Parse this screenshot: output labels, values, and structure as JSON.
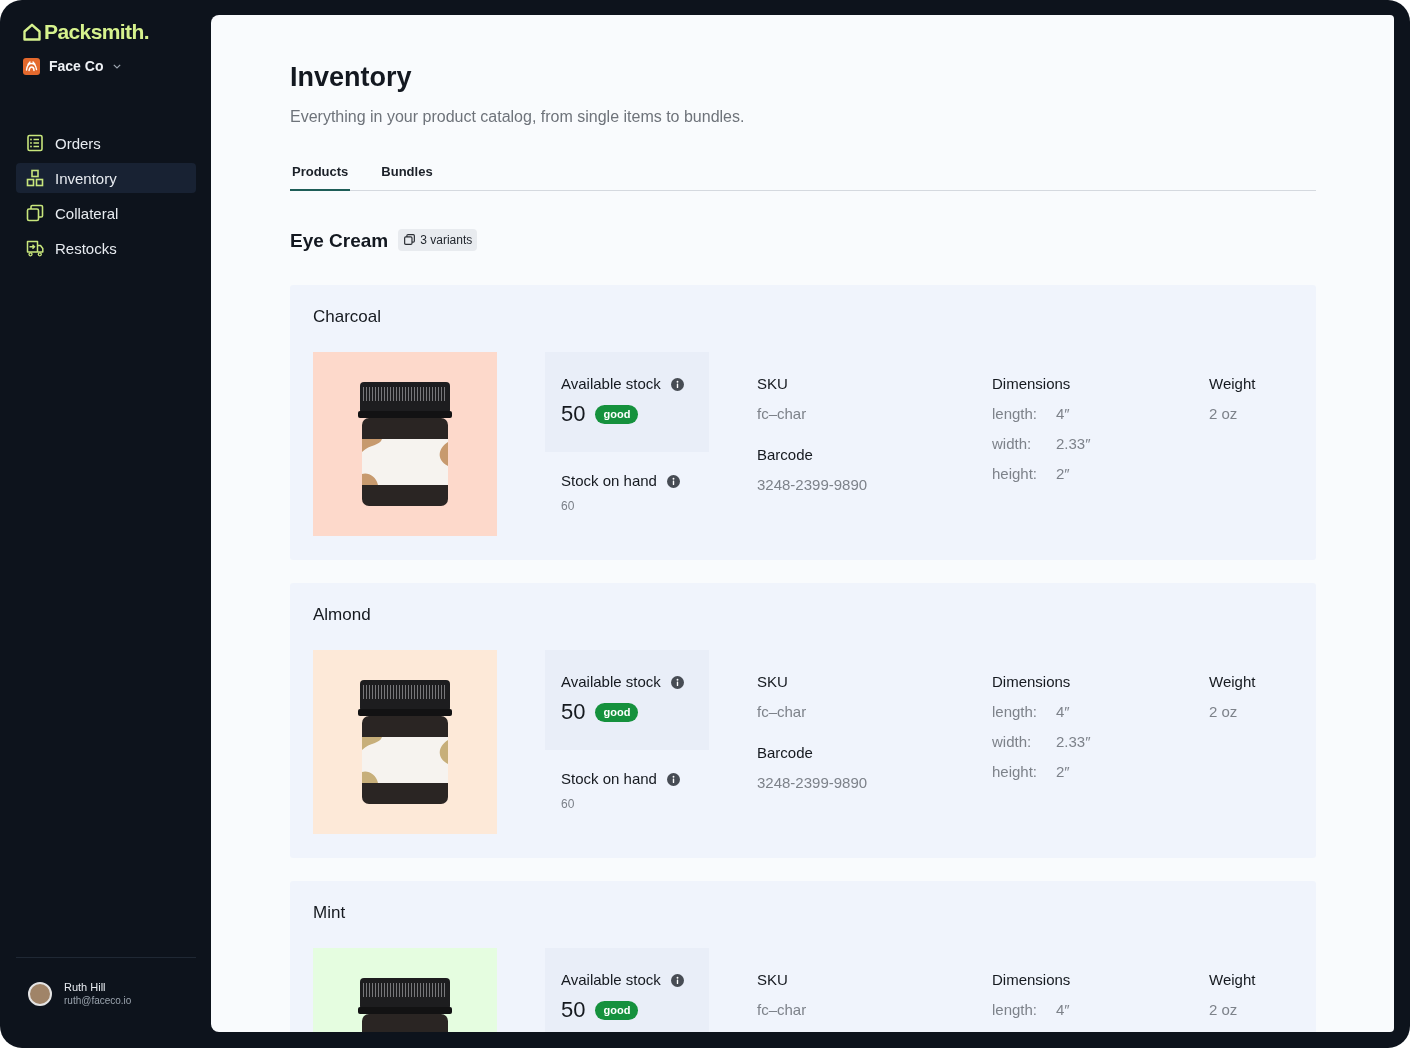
{
  "sidebar": {
    "logo": "Packsmith.",
    "org": "Face Co",
    "nav": [
      {
        "label": "Orders",
        "selected": false
      },
      {
        "label": "Inventory",
        "selected": true
      },
      {
        "label": "Collateral",
        "selected": false
      },
      {
        "label": "Restocks",
        "selected": false
      }
    ],
    "user": {
      "name": "Ruth Hill",
      "email": "ruth@faceco.io"
    }
  },
  "page": {
    "title": "Inventory",
    "subtitle": "Everything in your product catalog, from single items to bundles."
  },
  "tabs": [
    {
      "label": "Products",
      "selected": true
    },
    {
      "label": "Bundles",
      "selected": false
    }
  ],
  "product": {
    "name": "Eye Cream",
    "variants_badge": "3 variants"
  },
  "variants": [
    {
      "name": "Charcoal",
      "color": "#fdd9cb",
      "available_stock": {
        "label": "Available stock",
        "value": "50",
        "status": "good"
      },
      "stock_on_hand": {
        "label": "Stock on hand",
        "value": "60"
      },
      "sku": {
        "label": "SKU",
        "value": "fc–char"
      },
      "barcode": {
        "label": "Barcode",
        "value": "3248-2399-9890"
      },
      "dimensions": {
        "label": "Dimensions",
        "rows": [
          {
            "label": "length:",
            "value": "4″"
          },
          {
            "label": "width:",
            "value": "2.33″"
          },
          {
            "label": "height:",
            "value": "2″"
          }
        ]
      },
      "weight": {
        "label": "Weight",
        "value": "2 oz"
      }
    },
    {
      "name": "Almond",
      "color": "#fde9d8",
      "available_stock": {
        "label": "Available stock",
        "value": "50",
        "status": "good"
      },
      "stock_on_hand": {
        "label": "Stock on hand",
        "value": "60"
      },
      "sku": {
        "label": "SKU",
        "value": "fc–char"
      },
      "barcode": {
        "label": "Barcode",
        "value": "3248-2399-9890"
      },
      "dimensions": {
        "label": "Dimensions",
        "rows": [
          {
            "label": "length:",
            "value": "4″"
          },
          {
            "label": "width:",
            "value": "2.33″"
          },
          {
            "label": "height:",
            "value": "2″"
          }
        ]
      },
      "weight": {
        "label": "Weight",
        "value": "2 oz"
      }
    },
    {
      "name": "Mint",
      "color": "#e5fde0",
      "available_stock": {
        "label": "Available stock",
        "value": "50",
        "status": "good"
      },
      "sku": {
        "label": "SKU",
        "value": "fc–char"
      },
      "dimensions": {
        "label": "Dimensions",
        "rows": [
          {
            "label": "length:",
            "value": "4″"
          }
        ]
      },
      "weight": {
        "label": "Weight",
        "value": "2 oz"
      }
    }
  ]
}
